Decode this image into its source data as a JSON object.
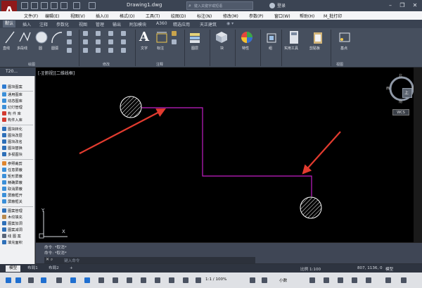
{
  "titlebar": {
    "logo": "A",
    "title": "Drawing1.dwg",
    "search_placeholder": "键入关键字或短语",
    "login": "登录"
  },
  "menu": [
    "文件(F)",
    "编辑(E)",
    "视图(V)",
    "插入(I)",
    "格式(O)",
    "工具(T)",
    "绘图(D)",
    "标注(N)",
    "修改(M)",
    "参数(P)",
    "窗口(W)",
    "帮助(H)",
    "M_批打印"
  ],
  "ribbon_tabs": [
    "默认",
    "插入",
    "注释",
    "参数化",
    "视图",
    "管理",
    "输出",
    "附加模块",
    "A360",
    "精选应用",
    "天正建筑"
  ],
  "ribbon": {
    "draw_tools": [
      "直线",
      "多段线",
      "圆",
      "圆弧"
    ],
    "text_label": "文字",
    "dim_label": "标注",
    "layer_label": "图层",
    "block_label": "块",
    "props_label": "特性",
    "group_label": "组",
    "utils_label": "实用工具",
    "clipboard_label": "剪贴板",
    "base_label": "基点",
    "panels": [
      "绘图",
      "修改",
      "注释",
      "视图"
    ]
  },
  "palette": {
    "header": "T20...",
    "items": [
      "图块图案",
      "通用图库",
      "动态图库",
      "幻灯管理",
      "构 件 库",
      "构件入库",
      "图块转化",
      "图块改层",
      "图块改名",
      "图块替换",
      "多视图块",
      "参照裁剪",
      "任意屏蔽",
      "矩形屏蔽",
      "精确屏蔽",
      "取消屏蔽",
      "屏蔽框开",
      "屏蔽框关",
      "图案管理",
      "木纹填充",
      "图案加洞",
      "图案减洞",
      "线 图 案",
      "填充面积"
    ]
  },
  "canvas": {
    "view_label": "[-][俯视][二维线框]",
    "compass": {
      "north": "北",
      "south": "南",
      "east": "东",
      "west": "西",
      "top": "上"
    },
    "wcs": "WCS",
    "ucs_x": "X",
    "ucs_y": "Y"
  },
  "command": {
    "history": [
      "命令: *取消*",
      "命令: *取消*"
    ],
    "prompt": "键入命令"
  },
  "layout_tabs": [
    "模型",
    "布局1",
    "布局2"
  ],
  "status": {
    "scale": "比例 1:100",
    "coords": "807, 1136, 0",
    "model": "模型",
    "ratio": "1:1 / 100%",
    "units": "小数"
  },
  "colors": {
    "line": "#c21fc6",
    "arrow": "#e23b2f",
    "canvas": "#000000"
  }
}
